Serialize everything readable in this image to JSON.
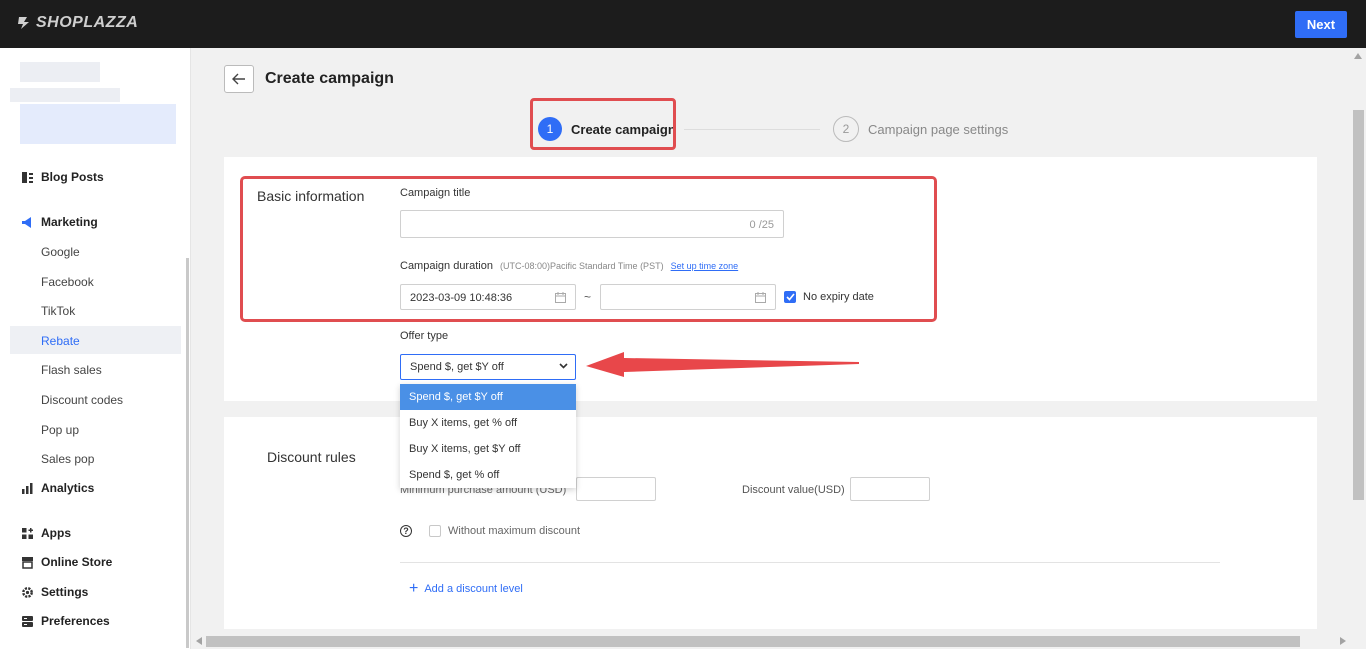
{
  "topbar": {
    "brand": "SHOPLAZZA",
    "next_label": "Next"
  },
  "sidebar": {
    "items": [
      {
        "label": "Blog Posts",
        "icon": "blog-icon"
      },
      {
        "label": "Marketing",
        "icon": "megaphone-icon"
      },
      {
        "label": "Analytics",
        "icon": "bar-chart-icon"
      },
      {
        "label": "Apps",
        "icon": "apps-icon"
      },
      {
        "label": "Online Store",
        "icon": "store-icon"
      },
      {
        "label": "Settings",
        "icon": "gear-icon"
      },
      {
        "label": "Preferences",
        "icon": "preferences-icon"
      }
    ],
    "marketing_sub": [
      "Google",
      "Facebook",
      "TikTok",
      "Rebate",
      "Flash sales",
      "Discount codes",
      "Pop up",
      "Sales pop"
    ],
    "active_sub": "Rebate"
  },
  "header": {
    "title": "Create campaign"
  },
  "steps": [
    {
      "num": "1",
      "label": "Create campaign"
    },
    {
      "num": "2",
      "label": "Campaign page settings"
    }
  ],
  "basic": {
    "section_title": "Basic information",
    "campaign_title_label": "Campaign title",
    "campaign_title_value": "",
    "counter": "0 /25",
    "duration_label": "Campaign duration",
    "timezone": "(UTC-08:00)Pacific Standard Time  (PST)",
    "timezone_link": "Set up time zone",
    "start_date": "2023-03-09 10:48:36",
    "end_date": "",
    "tilde": "~",
    "no_expiry_label": "No expiry date",
    "no_expiry_checked": true,
    "offer_type_label": "Offer type",
    "offer_type_selected": "Spend $, get $Y off",
    "offer_options": [
      "Spend $, get $Y off",
      "Buy X items, get % off",
      "Buy X items, get $Y off",
      "Spend $, get % off"
    ]
  },
  "discount": {
    "section_title": "Discount rules",
    "min_purchase_label": "Minimum purchase amount (USD)",
    "discount_value_label": "Discount value(USD)",
    "without_max_label": "Without maximum discount",
    "help_glyph": "?",
    "add_level_label": "Add a discount level"
  },
  "colors": {
    "accent": "#2f6df6",
    "highlight": "#e04d50",
    "topbar": "#1c1c1c"
  }
}
